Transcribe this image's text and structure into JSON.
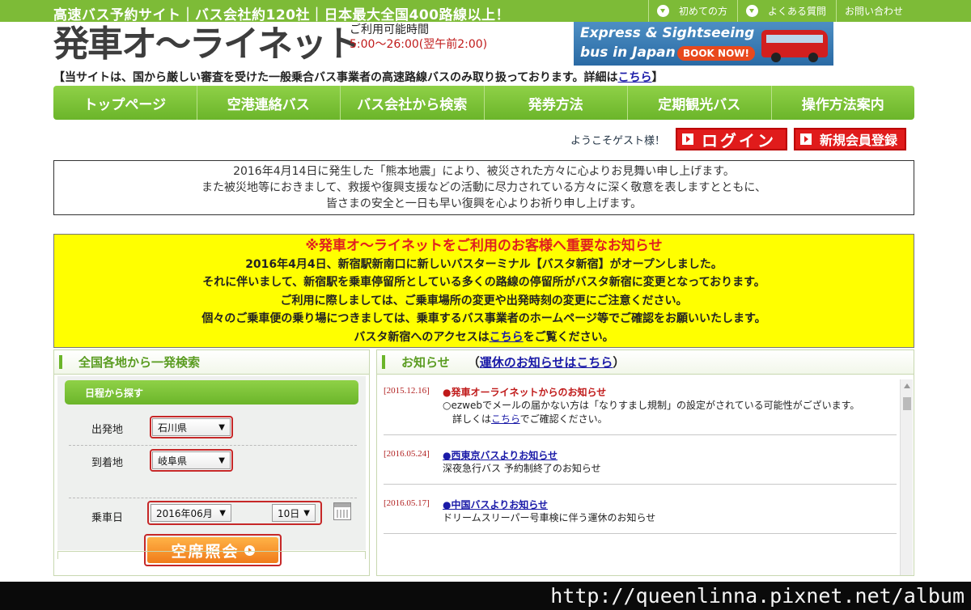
{
  "topbar": {
    "tagline": "高速バス予約サイト｜バス会社約120社｜日本最大全国400路線以上！",
    "links": [
      "初めての方",
      "よくある質問",
      "お問い合わせ"
    ],
    "accent_color": "#7dbb37"
  },
  "header": {
    "logo_text": "発車オ～ライネット",
    "hours_label": "ご利用可能時間",
    "hours_value": "5:00～26:00(翌午前2:00)",
    "banner_line1": "Express & Sightseeing",
    "banner_line2": "bus in Japan",
    "banner_button": "BOOK NOW!",
    "notice_text": "【当サイトは、国から厳しい審査を受けた一般乗合バス事業者の高速路線バスのみ取り扱っております。詳細は",
    "notice_link": "こちら",
    "notice_end": "】"
  },
  "nav": {
    "items": [
      "トップページ",
      "空港連絡バス",
      "バス会社から検索",
      "発券方法",
      "定期観光バス",
      "操作方法案内"
    ]
  },
  "account": {
    "welcome": "ようこそゲスト様！",
    "login": "ログイン",
    "register": "新規会員登録"
  },
  "condolence": {
    "lines": [
      "2016年4月14日に発生した「熊本地震」により、被災された方々に心よりお見舞い申し上げます。",
      "また被災地等におきまして、救援や復興支援などの活動に尽力されている方々に深く敬意を表しますとともに、",
      "皆さまの安全と一日も早い復興を心よりお祈り申し上げます。"
    ]
  },
  "important": {
    "title": "※発車オ～ライネットをご利用のお客様へ重要なお知らせ",
    "lines": [
      "2016年4月4日、新宿駅新南口に新しいバスターミナル【バスタ新宿】がオープンしました。",
      "それに伴いまして、新宿駅を乗車停留所としている多くの路線の停留所がバスタ新宿に変更となっております。",
      "ご利用に際しましては、ご乗車場所の変更や出発時刻の変更にご注意ください。",
      "個々のご乗車便の乗り場につきましては、乗車するバス事業者のホームページ等でご確認をお願いいたします。"
    ],
    "last_prefix": "バスタ新宿へのアクセスは",
    "last_link": "こちら",
    "last_suffix": "をご覧ください。"
  },
  "search": {
    "title": "全国各地から一発検索",
    "subhead": "日程から探す",
    "departure_label": "出発地",
    "departure_value": "石川県",
    "arrival_label": "到着地",
    "arrival_value": "岐阜県",
    "date_label": "乗車日",
    "month_value": "2016年06月",
    "day_value": "10日",
    "button": "空席照会"
  },
  "news": {
    "title": "お知らせ",
    "link_open": "（",
    "link_text": "運休のお知らせはこちら",
    "link_close": "）",
    "items": [
      {
        "date": "[2015.12.16]",
        "title": "●発車オーライネットからのお知らせ",
        "body1": "○ezwebでメールの届かない方は「なりすまし規制」の設定がされている可能性がございます。",
        "body2_prefix": "詳しくは",
        "body2_link": "こちら",
        "body2_suffix": "でご確認ください。"
      },
      {
        "date": "[2016.05.24]",
        "title": "●西東京バスよりお知らせ",
        "body1": "深夜急行バス 予約制終了のお知らせ"
      },
      {
        "date": "[2016.05.17]",
        "title": "●中国バスよりお知らせ",
        "body1": "ドリームスリーパー号車検に伴う運休のお知らせ"
      }
    ]
  },
  "footer": {
    "watermark": "http://queenlinna.pixnet.net/album"
  }
}
